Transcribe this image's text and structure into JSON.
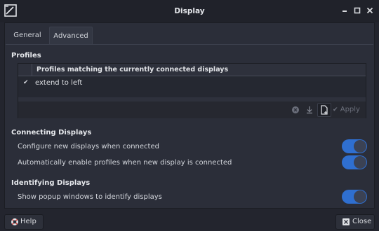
{
  "window": {
    "title": "Display"
  },
  "tabs": [
    {
      "label": "General",
      "active": false
    },
    {
      "label": "Advanced",
      "active": true
    }
  ],
  "profiles": {
    "section_title": "Profiles",
    "column_header": "Profiles matching the currently connected displays",
    "items": [
      {
        "name": "extend to left",
        "checked": true
      }
    ],
    "toolbar": {
      "apply_label": "Apply"
    }
  },
  "connecting": {
    "section_title": "Connecting Displays",
    "options": [
      {
        "label": "Configure new displays when connected",
        "enabled": true
      },
      {
        "label": "Automatically enable profiles when new display is connected",
        "enabled": true
      }
    ]
  },
  "identifying": {
    "section_title": "Identifying Displays",
    "options": [
      {
        "label": "Show popup windows to identify displays",
        "enabled": true
      }
    ]
  },
  "footer": {
    "help_label": "Help",
    "close_label": "Close"
  },
  "colors": {
    "accent": "#2f6fd0",
    "background": "#23252e"
  }
}
